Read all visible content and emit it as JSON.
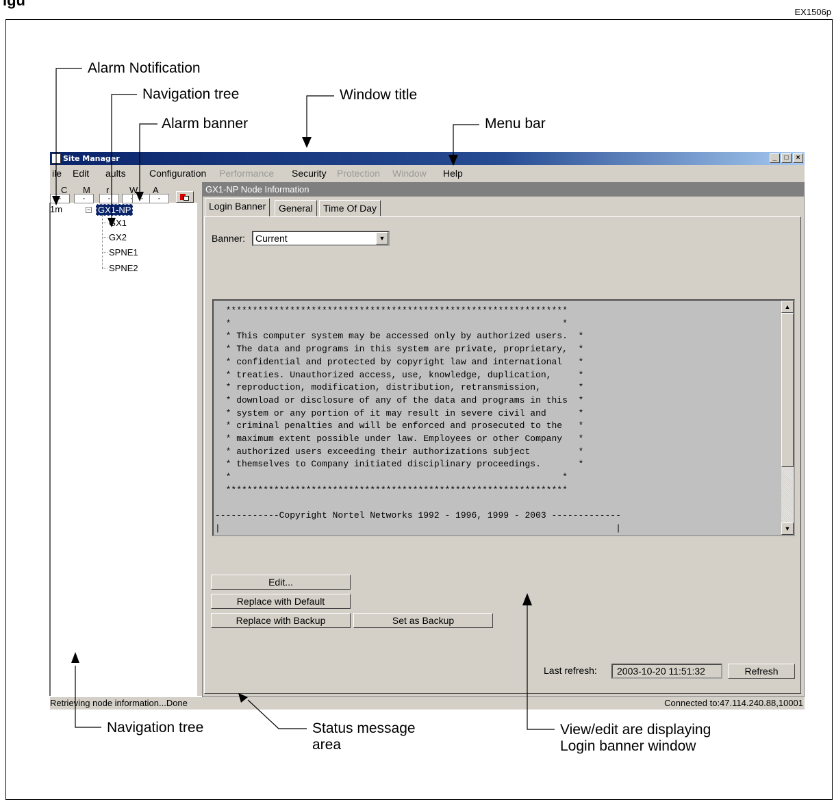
{
  "figure": {
    "title": "igu",
    "id": "EX1506p"
  },
  "callouts": {
    "alarm_notification": "Alarm Notification",
    "navigation_tree_top": "Navigation tree",
    "window_title": "Window title",
    "alarm_banner": "Alarm banner",
    "menu_bar": "Menu bar",
    "navigation_tree_bottom": "Navigation tree",
    "status_message_1": "Status message",
    "status_message_2": "area",
    "view_edit_1": "View/edit are displaying",
    "view_edit_2": "Login banner window"
  },
  "window": {
    "title": "Site Manager",
    "controls": {
      "minimize": "_",
      "maximize": "□",
      "close": "×"
    }
  },
  "menubar": {
    "items": [
      {
        "label": "ile",
        "enabled": true
      },
      {
        "label": "Edit",
        "enabled": true
      },
      {
        "label": "aults",
        "enabled": true
      },
      {
        "label": "Configuration",
        "enabled": true
      },
      {
        "label": "Performance",
        "enabled": false
      },
      {
        "label": "Security",
        "enabled": true
      },
      {
        "label": "Protection",
        "enabled": false
      },
      {
        "label": "Window",
        "enabled": false
      },
      {
        "label": "Help",
        "enabled": true
      }
    ]
  },
  "alarm_banner": {
    "severity_labels": [
      "C",
      "M",
      "r",
      "W",
      "A"
    ],
    "severity_values": [
      "-",
      "-",
      "-",
      "-",
      "-",
      "-"
    ]
  },
  "tree": {
    "timer": "1m",
    "collapse_glyph": "−",
    "root": "GX1-NP",
    "children": [
      "GX1",
      "GX2",
      "SPNE1",
      "SPNE2"
    ]
  },
  "panel": {
    "header": "GX1-NP Node Information",
    "tabs": [
      "Login Banner",
      "General",
      "Time Of Day"
    ],
    "active_tab": "Login Banner",
    "banner_label": "Banner:",
    "banner_value": "Current",
    "banner_text": "  ****************************************************************\n  *                                                              *\n  * This computer system may be accessed only by authorized users.  *\n  * The data and programs in this system are private, proprietary,  *\n  * confidential and protected by copyright law and international   *\n  * treaties. Unauthorized access, use, knowledge, duplication,     *\n  * reproduction, modification, distribution, retransmission,       *\n  * download or disclosure of any of the data and programs in this  *\n  * system or any portion of it may result in severe civil and      *\n  * criminal penalties and will be enforced and prosecuted to the   *\n  * maximum extent possible under law. Employees or other Company   *\n  * authorized users exceeding their authorizations subject         *\n  * themselves to Company initiated disciplinary proceedings.       *\n  *                                                              *\n  ****************************************************************\n\n------------Copyright Nortel Networks 1992 - 1996, 1999 - 2003 -------------\n|                                                                          |\n|  NOTICE: This is a private computer system.                              |",
    "buttons": {
      "edit": "Edit...",
      "replace_default": "Replace with Default",
      "replace_backup": "Replace with Backup",
      "set_backup": "Set as Backup",
      "refresh": "Refresh"
    },
    "last_refresh_label": "Last refresh:",
    "last_refresh_value": "2003-10-20 11:51:32"
  },
  "status": {
    "message": "Retrieving node information...Done",
    "connection": "Connected to:47.114.240.88,10001"
  }
}
